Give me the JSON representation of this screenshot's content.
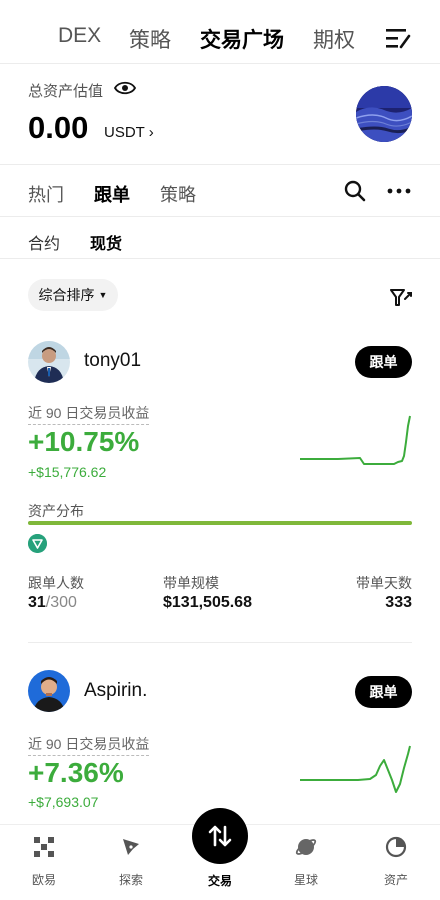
{
  "top_tabs": [
    "DEX",
    "策略",
    "交易广场",
    "期权"
  ],
  "asset": {
    "label": "总资产估值",
    "value": "0.00",
    "unit": "USDT ›"
  },
  "sub_tabs": [
    "热门",
    "跟单",
    "策略"
  ],
  "type_tabs": [
    "合约",
    "现货"
  ],
  "sort": {
    "label": "综合排序"
  },
  "traders": [
    {
      "name": "tony01",
      "follow_label": "跟单",
      "pnl_label": "近 90 日交易员收益",
      "pnl_pct": "+10.75%",
      "pnl_amount": "+$15,776.62",
      "dist_label": "资产分布",
      "stats": [
        {
          "label": "跟单人数",
          "value": "31",
          "suffix": "/300"
        },
        {
          "label": "带单规模",
          "value": "$131,505.68"
        },
        {
          "label": "带单天数",
          "value": "333"
        }
      ]
    },
    {
      "name": "Aspirin.",
      "follow_label": "跟单",
      "pnl_label": "近 90 日交易员收益",
      "pnl_pct": "+7.36%",
      "pnl_amount": "+$7,693.07"
    }
  ],
  "bottom_nav": [
    {
      "label": "欧易",
      "icon": "okx-logo-icon"
    },
    {
      "label": "探索",
      "icon": "compass-icon"
    },
    {
      "label": "交易",
      "icon": "swap-arrows-icon"
    },
    {
      "label": "星球",
      "icon": "planet-icon"
    },
    {
      "label": "资产",
      "icon": "pie-chart-icon"
    }
  ],
  "colors": {
    "profit_green": "#3cac3c",
    "allocation_bar": "#7fb83a",
    "primary_button": "#000000"
  }
}
